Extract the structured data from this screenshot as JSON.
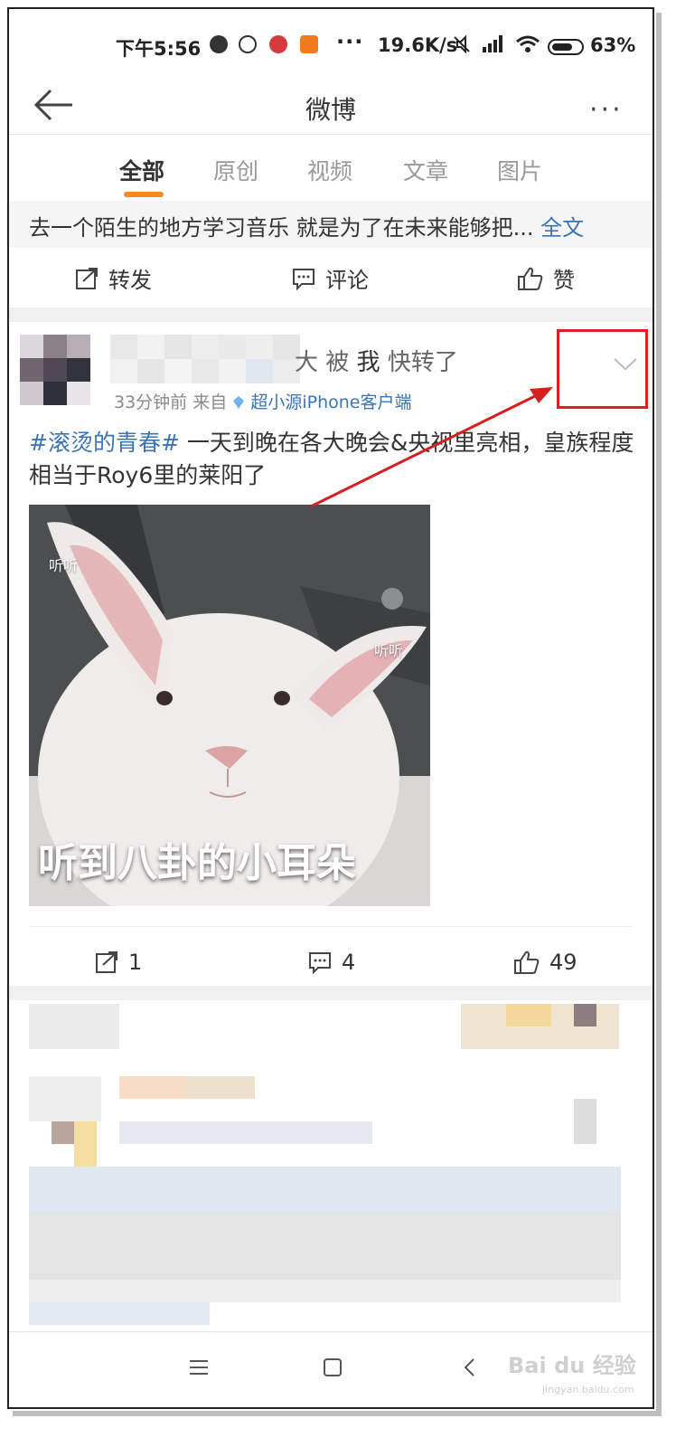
{
  "status_bar": {
    "time": "下午5:56",
    "dots": "···",
    "net_speed": "19.6K/s",
    "battery": "63%"
  },
  "nav": {
    "title": "微博",
    "more": "···"
  },
  "tabs": [
    {
      "label": "全部",
      "active": true
    },
    {
      "label": "原创",
      "active": false
    },
    {
      "label": "视频",
      "active": false
    },
    {
      "label": "文章",
      "active": false
    },
    {
      "label": "图片",
      "active": false
    }
  ],
  "prev_post": {
    "text": "去一个陌生的地方学习音乐 就是为了在未来能够把...",
    "full_link": "全文",
    "actions": {
      "repost": "转发",
      "comment": "评论",
      "like": "赞"
    }
  },
  "post": {
    "repost_prefix": "大",
    "repost_by": "被",
    "repost_me": "我",
    "repost_suffix": "快转了",
    "meta_time": "33分钟前",
    "meta_from": "来自",
    "meta_source": "超小源iPhone客户端",
    "hashtag": "#滚烫的青春#",
    "text": " 一天到晚在各大晚会&央视里亮相，皇族程度相当于Roy6里的莱阳了",
    "image": {
      "ear_label_left": "听听",
      "ear_label_right": "听听",
      "caption": "听到八卦的小耳朵"
    },
    "actions": {
      "repost_count": "1",
      "comment_count": "4",
      "like_count": "49"
    }
  },
  "watermark": {
    "text": "Bai du 经验",
    "sub": "jingyan.baidu.com"
  },
  "colors": {
    "accent": "#f58a23",
    "link": "#3a74b4",
    "highlight": "#e02020"
  }
}
